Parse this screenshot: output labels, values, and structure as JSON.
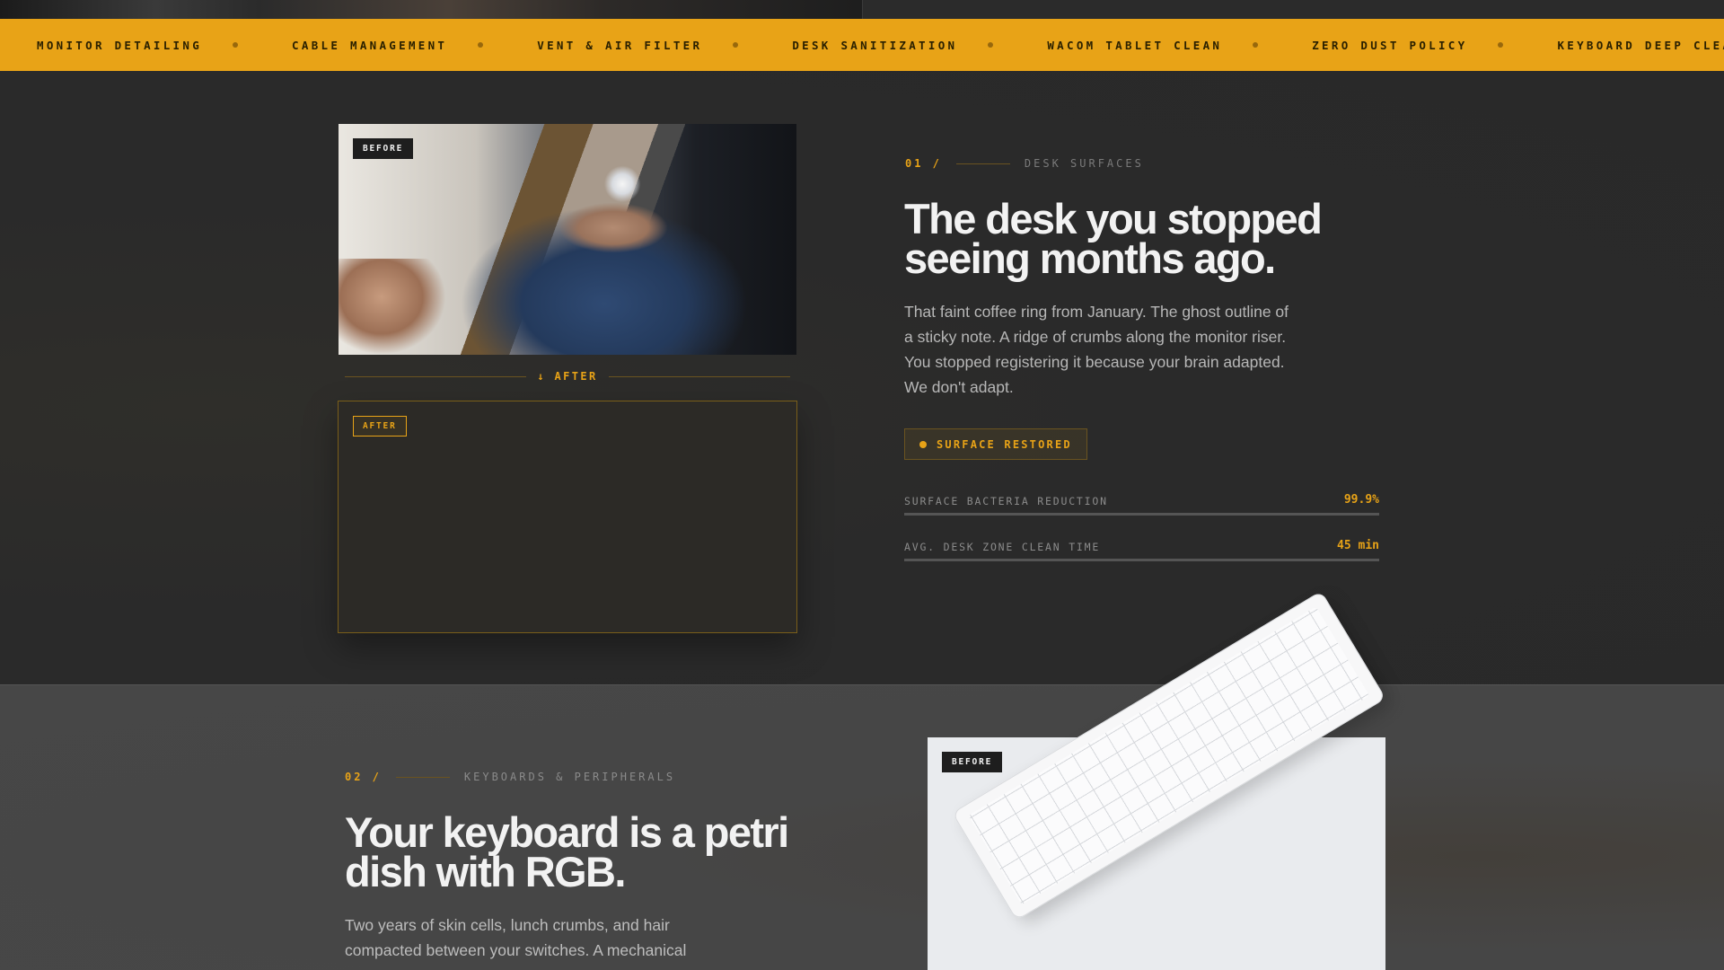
{
  "ticker": {
    "items": [
      "MONITOR DETAILING",
      "CABLE MANAGEMENT",
      "VENT & AIR FILTER",
      "DESK SANITIZATION",
      "WACOM TABLET CLEAN",
      "ZERO DUST POLICY",
      "KEYBOARD DEEP CLEAN"
    ]
  },
  "section_one": {
    "before_tag": "BEFORE",
    "after_divider": "↓ AFTER",
    "after_tag": "AFTER",
    "number": "01 /",
    "category": "DESK SURFACES",
    "headline_line1": "The desk you stopped",
    "headline_line2": "seeing months ago.",
    "body": [
      "That faint coffee ring from January. The ghost outline of",
      "a sticky note. A ridge of crumbs along the monitor riser.",
      "You stopped registering it because your brain adapted.",
      "We don't adapt."
    ],
    "status_badge": "SURFACE RESTORED",
    "stats": [
      {
        "label": "SURFACE BACTERIA REDUCTION",
        "value": "99.9%"
      },
      {
        "label": "AVG. DESK ZONE CLEAN TIME",
        "value": "45 min"
      }
    ]
  },
  "section_two": {
    "number": "02 /",
    "category": "KEYBOARDS & PERIPHERALS",
    "headline_line1": "Your keyboard is a petri",
    "headline_line2": "dish with RGB.",
    "body": [
      "Two years of skin cells, lunch crumbs, and hair",
      "compacted between your switches. A mechanical"
    ],
    "before_tag": "BEFORE"
  },
  "colors": {
    "accent": "#e8a317",
    "dark_bg": "#2a2a2a",
    "mid_bg": "#474747"
  }
}
